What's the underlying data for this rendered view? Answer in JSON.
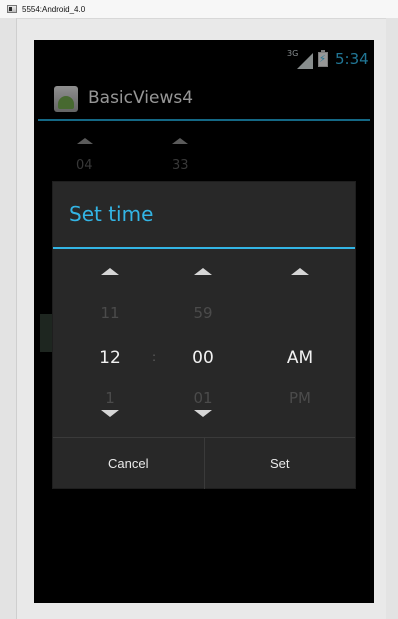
{
  "window": {
    "title": "5554:Android_4.0"
  },
  "status_bar": {
    "network_label": "3G",
    "time": "5:34"
  },
  "action_bar": {
    "app_title": "BasicViews4"
  },
  "background_picker": {
    "hour": "04",
    "minute": "33"
  },
  "dialog": {
    "title": "Set time",
    "hour": {
      "prev": "11",
      "current": "12",
      "next": "1"
    },
    "separator": ":",
    "minute": {
      "prev": "59",
      "current": "00",
      "next": "01"
    },
    "ampm": {
      "prev": "",
      "current": "AM",
      "next": "PM"
    },
    "buttons": {
      "cancel": "Cancel",
      "set": "Set"
    }
  },
  "colors": {
    "accent": "#33b5e5",
    "dialog_bg": "#282828",
    "screen_bg": "#000000"
  }
}
